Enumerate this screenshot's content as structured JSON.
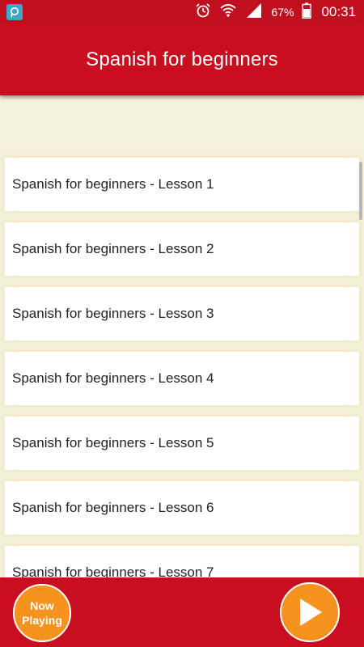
{
  "status_bar": {
    "battery_percent": "67%",
    "time": "00:31",
    "icons": [
      "app-notification-icon",
      "alarm-icon",
      "wifi-icon",
      "signal-icon",
      "battery-icon"
    ]
  },
  "app_bar": {
    "title": "Spanish for beginners"
  },
  "lessons": [
    "Spanish for beginners - Lesson 1",
    "Spanish for beginners - Lesson 2",
    "Spanish for beginners - Lesson 3",
    "Spanish for beginners - Lesson 4",
    "Spanish for beginners - Lesson 5",
    "Spanish for beginners - Lesson 6",
    "Spanish for beginners - Lesson 7"
  ],
  "bottom_bar": {
    "now_playing_label": "Now Playing",
    "play_icon": "play-icon"
  },
  "colors": {
    "primary": "#c90e1f",
    "accent": "#f6921e",
    "background": "#f5f2dc",
    "card": "#ffffff"
  }
}
